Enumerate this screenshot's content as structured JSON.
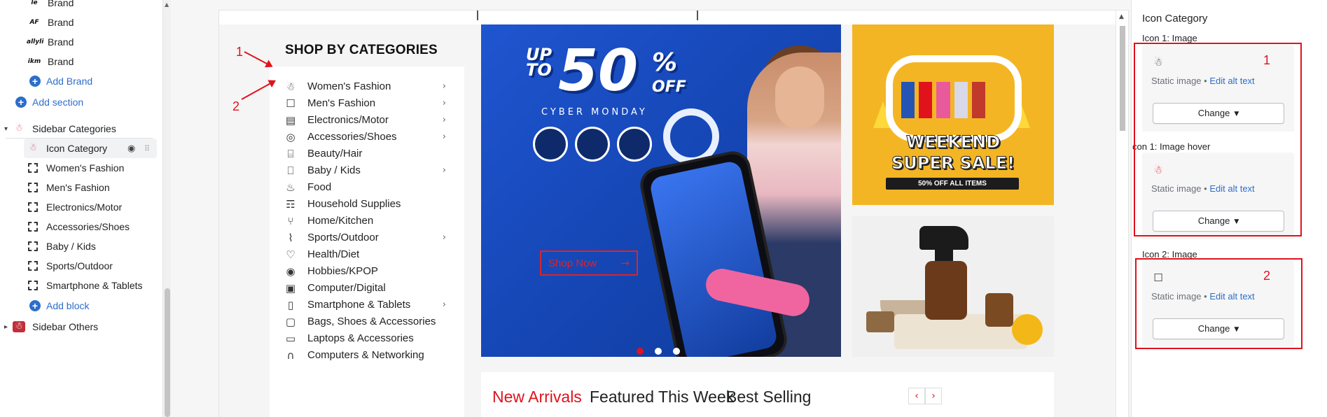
{
  "left_panel": {
    "brand_items": [
      "Brand",
      "Brand",
      "Brand",
      "Brand"
    ],
    "brand_icons": [
      "le",
      "AF",
      "allyli",
      "ikm"
    ],
    "add_brand": "Add Brand",
    "add_section": "Add section",
    "sidebar_categories": "Sidebar Categories",
    "icon_category": "Icon Category",
    "blocks": [
      "Women's Fashion",
      "Men's Fashion",
      "Electronics/Motor",
      "Accessories/Shoes",
      "Baby / Kids",
      "Sports/Outdoor",
      "Smartphone & Tablets"
    ],
    "add_block": "Add block",
    "sidebar_others": "Sidebar Others"
  },
  "preview": {
    "shop_by_categories": "SHOP BY CATEGORIES",
    "categories": [
      {
        "label": "Women's Fashion",
        "icon": "dress-icon",
        "glyph": "☃",
        "chevron": true
      },
      {
        "label": "Men's Fashion",
        "icon": "shirt-icon",
        "glyph": "☐",
        "chevron": true
      },
      {
        "label": "Electronics/Motor",
        "icon": "appliance-icon",
        "glyph": "▤",
        "chevron": true
      },
      {
        "label": "Accessories/Shoes",
        "icon": "ring-icon",
        "glyph": "◎",
        "chevron": true
      },
      {
        "label": "Beauty/Hair",
        "icon": "lipstick-icon",
        "glyph": "⌸",
        "chevron": false
      },
      {
        "label": "Baby / Kids",
        "icon": "bottle-icon",
        "glyph": "⎕",
        "chevron": true
      },
      {
        "label": "Food",
        "icon": "bowl-icon",
        "glyph": "♨",
        "chevron": false
      },
      {
        "label": "Household Supplies",
        "icon": "broom-icon",
        "glyph": "☶",
        "chevron": false
      },
      {
        "label": "Home/Kitchen",
        "icon": "utensils-icon",
        "glyph": "⑂",
        "chevron": false
      },
      {
        "label": "Sports/Outdoor",
        "icon": "shoe-icon",
        "glyph": "⌇",
        "chevron": true
      },
      {
        "label": "Health/Diet",
        "icon": "heart-pulse-icon",
        "glyph": "♡",
        "chevron": false
      },
      {
        "label": "Hobbies/KPOP",
        "icon": "disc-icon",
        "glyph": "◉",
        "chevron": false
      },
      {
        "label": "Computer/Digital",
        "icon": "camera-icon",
        "glyph": "▣",
        "chevron": false
      },
      {
        "label": "Smartphone & Tablets",
        "icon": "phone-icon",
        "glyph": "▯",
        "chevron": true
      },
      {
        "label": "Bags, Shoes & Accessories",
        "icon": "bag-icon",
        "glyph": "▢",
        "chevron": false
      },
      {
        "label": "Laptops & Accessories",
        "icon": "laptop-icon",
        "glyph": "▭",
        "chevron": false
      },
      {
        "label": "Computers & Networking",
        "icon": "headset-icon",
        "glyph": "∩",
        "chevron": false
      }
    ],
    "hero": {
      "up_to": "UP TO",
      "big": "50",
      "pct": "%",
      "off": "OFF",
      "cyber": "CYBER MONDAY",
      "shop_now": "Shop Now",
      "arrow": "→"
    },
    "banner1": {
      "line1": "WEEKEND",
      "line2": "SUPER SALE!",
      "pill": "50% OFF ALL ITEMS"
    },
    "tabs": [
      "New Arrivals",
      "Featured This Week",
      "Best Selling"
    ],
    "prev": "‹",
    "next": "›",
    "annotations": {
      "one": "1",
      "two": "2"
    },
    "colors": {
      "accent": "#e0121c",
      "hero": "#1f55d0",
      "banner1": "#f4b524"
    }
  },
  "right_panel": {
    "title": "Icon Category",
    "icon1_image_label": "Icon 1: Image",
    "icon1_hover_label": "con 1: Image hover",
    "icon2_image_label": "Icon 2: Image",
    "static_image": "Static image",
    "bullet": "•",
    "edit_alt": "Edit alt text",
    "change": "Change",
    "markers": {
      "one": "1",
      "two": "2"
    }
  }
}
